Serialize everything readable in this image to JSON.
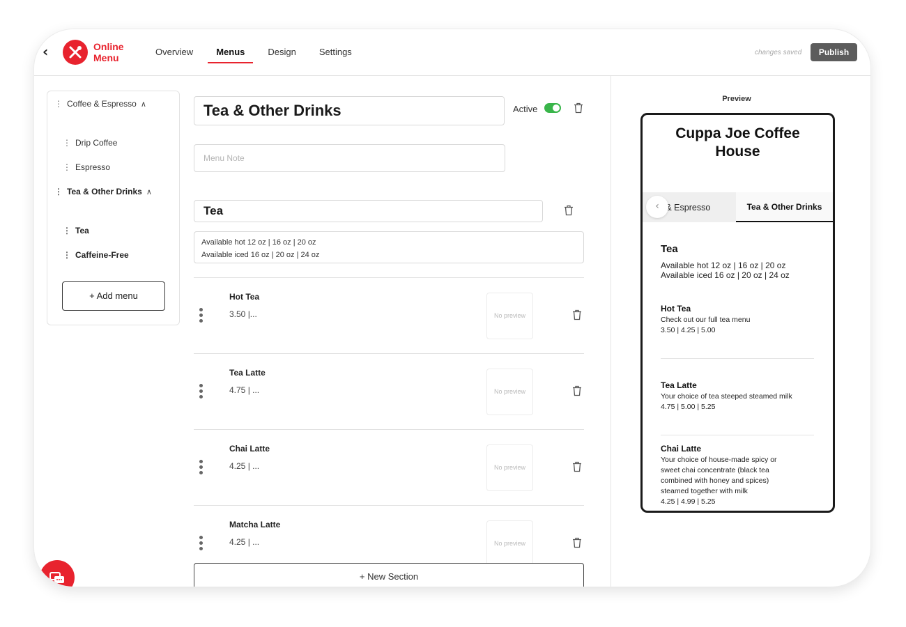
{
  "header": {
    "brand_line1": "Online",
    "brand_line2": "Menu",
    "tabs": [
      {
        "label": "Overview"
      },
      {
        "label": "Menus"
      },
      {
        "label": "Design"
      },
      {
        "label": "Settings"
      }
    ],
    "status": "changes saved",
    "publish_label": "Publish"
  },
  "sidebar": {
    "menus": [
      {
        "label": "Coffee & Espresso",
        "items": [
          "Drip Coffee",
          "Espresso"
        ]
      },
      {
        "label": "Tea & Other Drinks",
        "items": [
          "Tea",
          "Caffeine-Free"
        ]
      }
    ],
    "add_menu_label": "+ Add menu"
  },
  "editor": {
    "menu_title": "Tea & Other Drinks",
    "active_label": "Active",
    "active": true,
    "menu_note_placeholder": "Menu Note",
    "section_title": "Tea",
    "section_description": [
      "Available hot 12 oz | 16 oz | 20 oz",
      "Available iced 16 oz | 20 oz | 24 oz"
    ],
    "no_preview_label": "No preview",
    "items": [
      {
        "name": "Hot Tea",
        "price": "3.50 |..."
      },
      {
        "name": "Tea Latte",
        "price": "4.75 | ..."
      },
      {
        "name": "Chai Latte",
        "price": "4.25 | ..."
      },
      {
        "name": "Matcha Latte",
        "price": "4.25 | ..."
      }
    ],
    "new_section_label": "+ New Section"
  },
  "preview": {
    "label": "Preview",
    "shop_name_line1": "Cuppa Joe Coffee",
    "shop_name_line2": "House",
    "tab_partial": "ee & Espresso",
    "tab_active": "Tea & Other Drinks",
    "section_title": "Tea",
    "section_description": [
      "Available hot 12 oz | 16 oz | 20 oz",
      "Available iced 16 oz | 20 oz | 24 oz"
    ],
    "items": [
      {
        "name": "Hot Tea",
        "description": [
          "Check out our full tea menu"
        ],
        "prices": "3.50 | 4.25 | 5.00"
      },
      {
        "name": "Tea Latte",
        "description": [
          "Your choice of tea steeped steamed milk"
        ],
        "prices": "4.75 | 5.00 | 5.25"
      },
      {
        "name": "Chai Latte",
        "description": [
          "Your choice of house-made spicy or",
          "sweet chai concentrate (black tea",
          "combined with honey and spices)",
          "steamed together with milk"
        ],
        "prices": "4.25 | 4.99 | 5.25"
      }
    ]
  },
  "colors": {
    "brand": "#e8232e",
    "toggle_on": "#39b54a",
    "publish_bg": "#5c5c5c"
  }
}
